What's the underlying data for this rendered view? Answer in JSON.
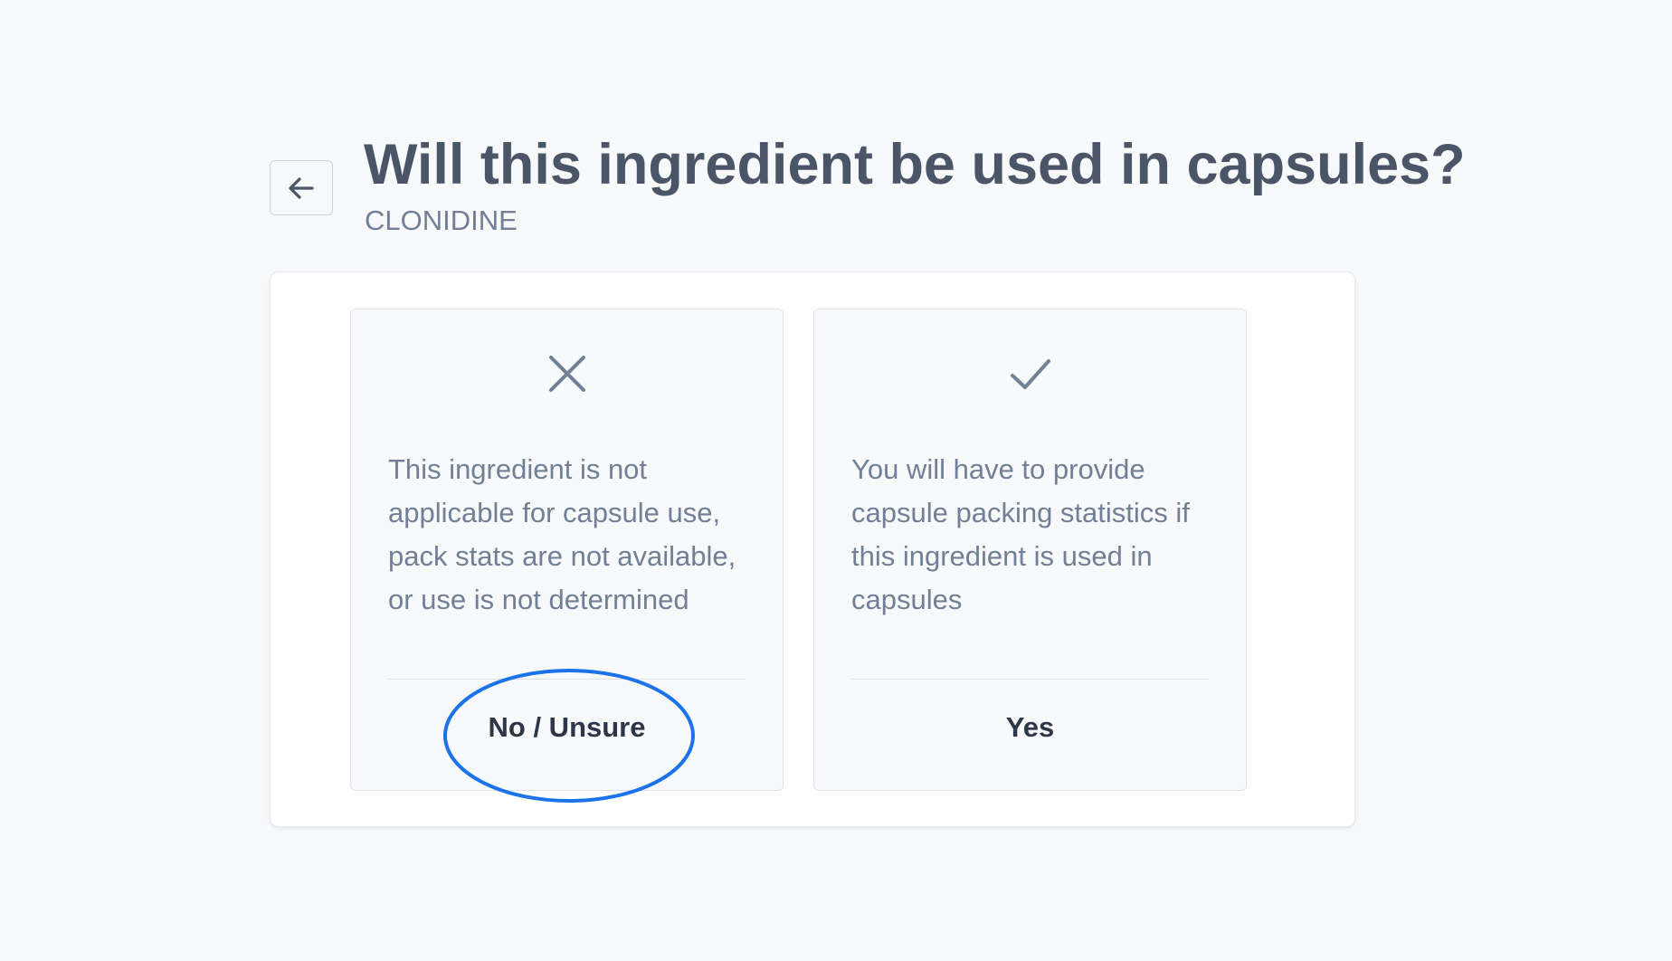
{
  "header": {
    "title": "Will this ingredient be used in capsules?",
    "subtitle": "CLONIDINE",
    "back_icon": "arrow-left-icon"
  },
  "options": [
    {
      "icon": "x-icon",
      "description": "This ingredient is not applicable for capsule use, pack stats are not available, or use is not determined",
      "action_label": "No / Unsure"
    },
    {
      "icon": "check-icon",
      "description": "You will have to provide capsule packing statistics if this ingredient is used in capsules",
      "action_label": "Yes"
    }
  ],
  "colors": {
    "background": "#f7f9fb",
    "title_text": "#4a5568",
    "muted_text": "#718096",
    "card_border": "#dfe3e9",
    "annotation_blue": "#1a73e8"
  }
}
